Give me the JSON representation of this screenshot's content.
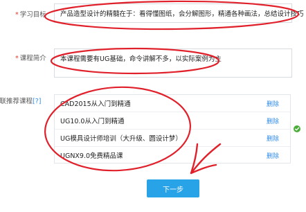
{
  "form": {
    "goal": {
      "label": "学习目标",
      "value": "产品造型设计的精髓在于：看得懂图纸，会分解图形，精通各种画法，总结设计技巧"
    },
    "intro": {
      "label": "课程简介",
      "value": "本课程需要有UG基础，命令讲解不多，以实际案例为主"
    },
    "related": {
      "label": "关联推荐课程",
      "help": "[?]",
      "courses": [
        {
          "title": "CAD2015从入门到精通",
          "action": "删除"
        },
        {
          "title": "UG10.0从入门到精通",
          "action": "删除"
        },
        {
          "title": "UG模具设计师培训（大升级、圆设计梦）",
          "action": "删除"
        },
        {
          "title": "UGNX9.0免费精品课",
          "action": "删除"
        }
      ]
    },
    "next_label": "下一步",
    "required_mark": "*"
  },
  "colors": {
    "accent": "#29a3e8",
    "link": "#2f8be6",
    "annotation": "#e0202a",
    "ok": "#4cae3a"
  },
  "icons": {
    "status": "check-circle-icon"
  }
}
